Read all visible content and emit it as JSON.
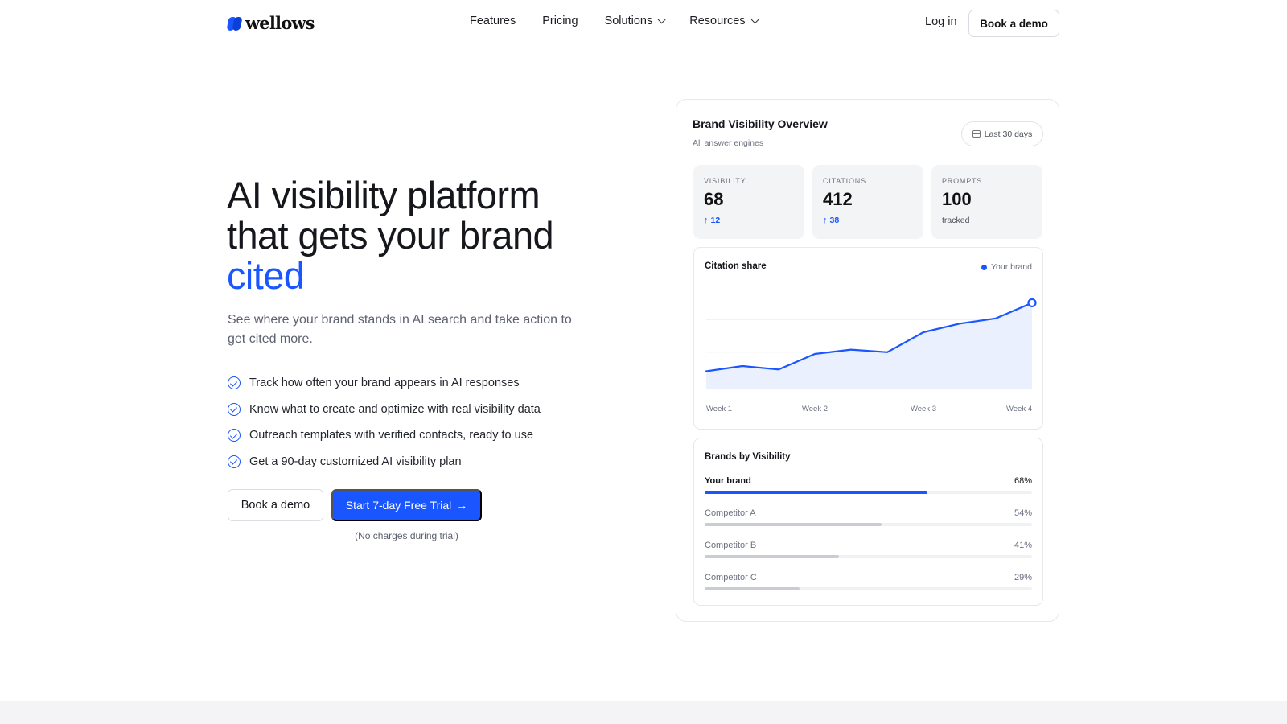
{
  "nav": {
    "logo_text": "wellows",
    "links": [
      {
        "label": "Features",
        "has_dropdown": false
      },
      {
        "label": "Pricing",
        "has_dropdown": false
      },
      {
        "label": "Solutions",
        "has_dropdown": true
      },
      {
        "label": "Resources",
        "has_dropdown": true
      }
    ],
    "login_label": "Log in",
    "demo_label": "Book a demo"
  },
  "hero": {
    "title_line1": "AI visibility platform",
    "title_line2": "that gets your brand",
    "title_accent": "cited",
    "subtitle": "See where your brand stands in AI search and take action to get cited more.",
    "features": [
      "Track how often your brand appears in AI responses",
      "Know what to create and optimize with real visibility data",
      "Outreach templates with verified contacts, ready to use",
      "Get a 90-day customized AI visibility plan"
    ],
    "demo_button": "Book a demo",
    "trial_button": "Start 7-day Free Trial",
    "trial_arrow": "→",
    "no_charges": "(No charges during trial)"
  },
  "dashboard": {
    "title": "Brand Visibility Overview",
    "subtitle": "All answer engines",
    "period": "Last 30 days",
    "stats": [
      {
        "label": "VISIBILITY",
        "value": "68",
        "delta": "12"
      },
      {
        "label": "CITATIONS",
        "value": "412",
        "delta": "38"
      },
      {
        "label": "PROMPTS",
        "value": "100",
        "note": "tracked"
      }
    ],
    "brands_title": "Brands by Visibility",
    "brands": [
      {
        "name": "Your brand",
        "pct_label": "68%",
        "value": 68
      },
      {
        "name": "Competitor A",
        "pct_label": "54%",
        "value": 54
      },
      {
        "name": "Competitor B",
        "pct_label": "41%",
        "value": 41
      },
      {
        "name": "Competitor C",
        "pct_label": "29%",
        "value": 29
      }
    ]
  },
  "colors": {
    "accent": "#1a56ff",
    "area_fill": "#eaf0fe",
    "bar_gray": "#c9ccd3"
  },
  "chart_data": {
    "type": "area",
    "title": "Citation share",
    "x_tick_labels": [
      "Week 1",
      "Week 2",
      "Week 3",
      "Week 4"
    ],
    "series": [
      {
        "name": "Your brand",
        "values": [
          20,
          26,
          22,
          40,
          45,
          42,
          65,
          75,
          81,
          99
        ]
      }
    ],
    "ylim": [
      0,
      105
    ],
    "grid": true,
    "legend": "top-right"
  }
}
